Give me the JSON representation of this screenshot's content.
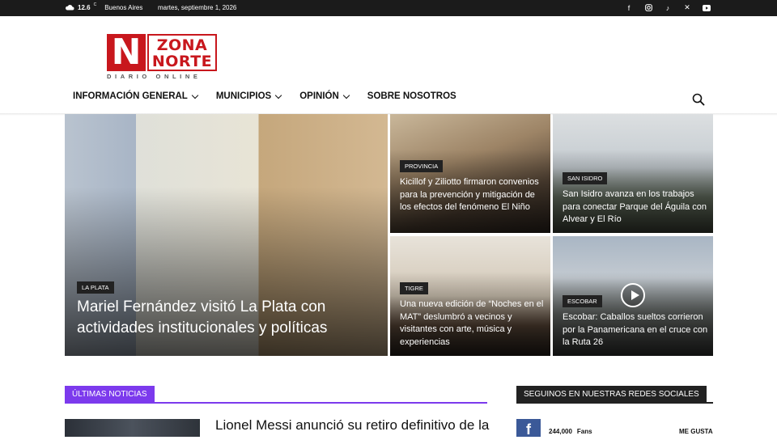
{
  "topbar": {
    "temperature": "12.6",
    "unit": "C",
    "city": "Buenos Aires",
    "date": "martes, septiembre 1, 2026",
    "social_icons": [
      "facebook-icon",
      "instagram-icon",
      "tiktok-icon",
      "x-icon",
      "youtube-icon"
    ]
  },
  "logo": {
    "letter": "N",
    "line1": "ZONA",
    "line2": "NORTE",
    "tagline": "DIARIO ONLINE"
  },
  "nav": {
    "items": [
      {
        "label": "INFORMACIÓN GENERAL",
        "dropdown": true
      },
      {
        "label": "MUNICIPIOS",
        "dropdown": true
      },
      {
        "label": "OPINIÓN",
        "dropdown": true
      },
      {
        "label": "SOBRE NOSOTROS",
        "dropdown": false
      }
    ]
  },
  "hero": [
    {
      "category": "LA PLATA",
      "title": "Mariel Fernández visitó La Plata con actividades institucionales y políticas"
    },
    {
      "category": "PROVINCIA",
      "title": "Kicillof y Ziliotto firmaron convenios para la prevención y mitigación de los efectos del fenómeno El Niño"
    },
    {
      "category": "SAN ISIDRO",
      "title": "San Isidro avanza en los trabajos para conectar Parque del Águila con Alvear y El Río"
    },
    {
      "category": "TIGRE",
      "title": "Una nueva edición de “Noches en el MAT” deslumbró a vecinos y visitantes con arte, música y experiencias"
    },
    {
      "category": "ESCOBAR",
      "title": "Escobar: Caballos sueltos corrieron por la Panamericana en el cruce con la Ruta 26"
    }
  ],
  "latest": {
    "heading": "ÚLTIMAS NOTICIAS",
    "headline": "Lionel Messi anunció su retiro definitivo de la"
  },
  "social_block": {
    "heading": "SEGUINOS EN NUESTRAS REDES SOCIALES",
    "count": "244,000",
    "fans_label": "Fans",
    "action": "ME GUSTA"
  },
  "colors": {
    "brand_red": "#c8171d",
    "accent_purple": "#7c3aed",
    "facebook_blue": "#3b5998"
  }
}
